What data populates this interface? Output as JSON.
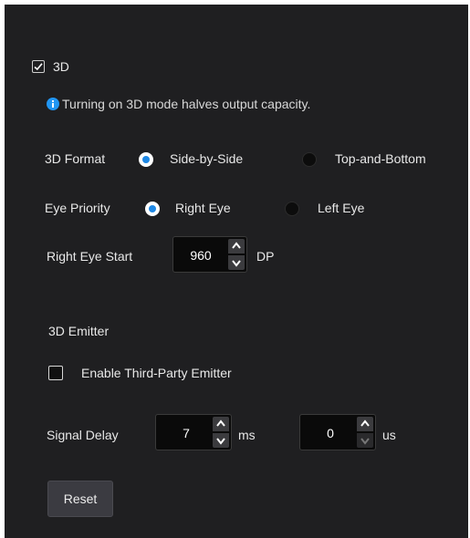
{
  "mode3d": {
    "label": "3D",
    "checked": true
  },
  "info": {
    "icon": "info-icon",
    "text": "Turning on 3D mode halves output capacity."
  },
  "format": {
    "label": "3D Format",
    "options": [
      {
        "label": "Side-by-Side",
        "selected": true
      },
      {
        "label": "Top-and-Bottom",
        "selected": false
      }
    ]
  },
  "eye_priority": {
    "label": "Eye Priority",
    "options": [
      {
        "label": "Right Eye",
        "selected": true
      },
      {
        "label": "Left Eye",
        "selected": false
      }
    ]
  },
  "right_eye_start": {
    "label": "Right Eye Start",
    "value": "960",
    "unit": "DP"
  },
  "emitter": {
    "section_title": "3D Emitter",
    "third_party": {
      "label": "Enable Third-Party Emitter",
      "checked": false
    }
  },
  "signal_delay": {
    "label": "Signal Delay",
    "ms": {
      "value": "7",
      "unit": "ms"
    },
    "us": {
      "value": "0",
      "unit": "us"
    }
  },
  "reset_label": "Reset",
  "colors": {
    "accent": "#1e88e5",
    "panel_bg": "#1f1f21",
    "input_bg": "#0a0a0a"
  }
}
